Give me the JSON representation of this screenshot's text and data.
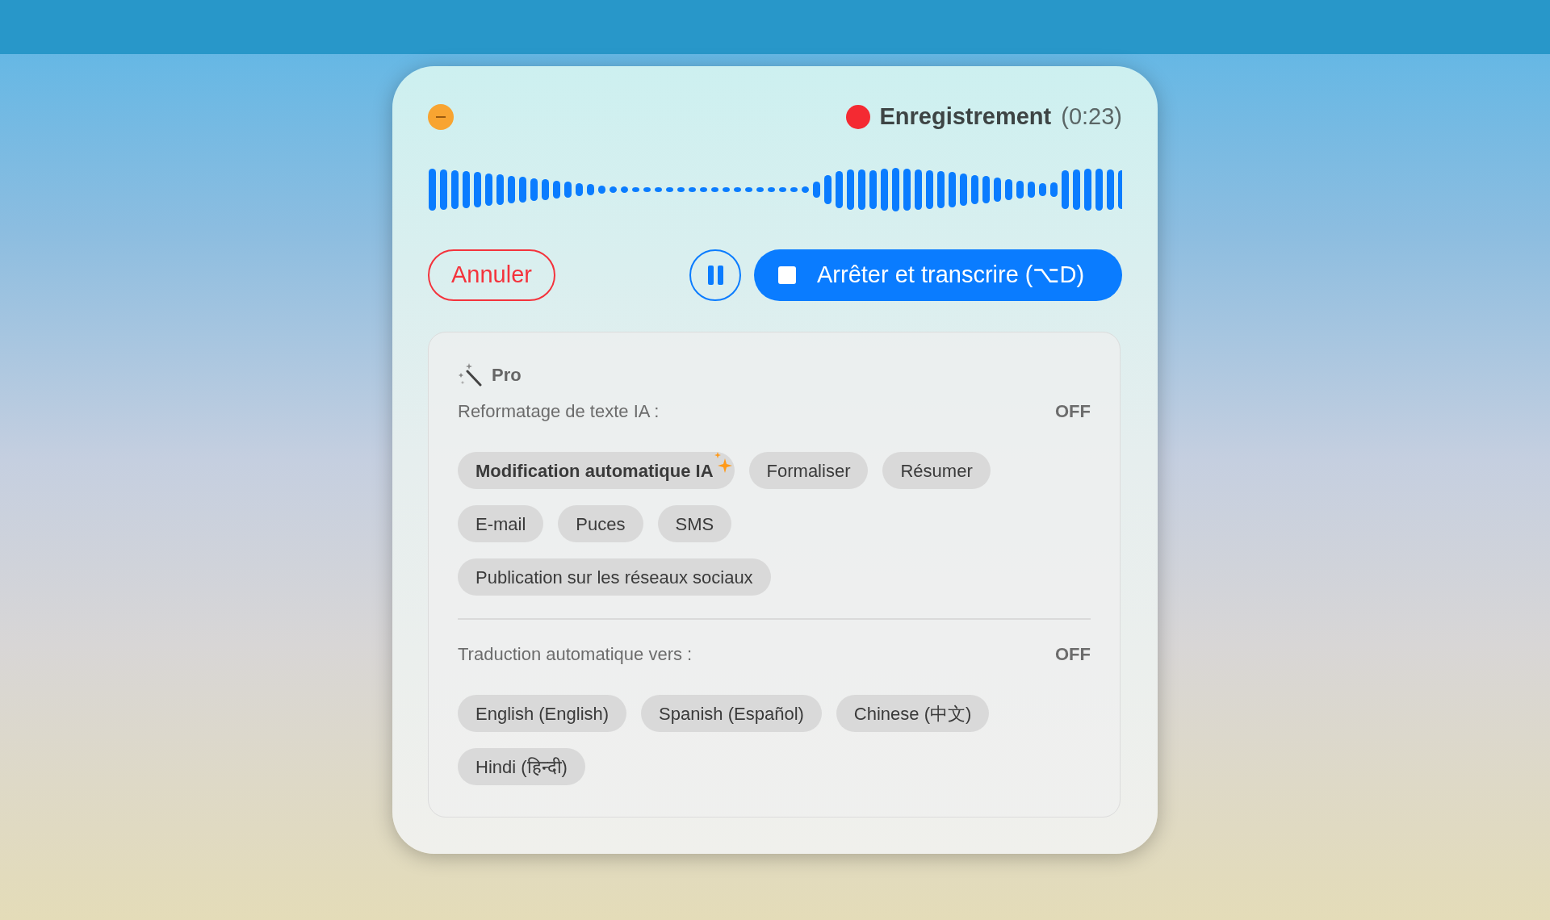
{
  "header": {
    "status": "Enregistrement",
    "time": "(0:23)"
  },
  "controls": {
    "cancel": "Annuler",
    "stop": "Arrêter et transcrire (⌥D)"
  },
  "pro": {
    "label": "Pro",
    "sections": [
      {
        "title": "Reformatage de texte IA :",
        "state": "OFF",
        "chips": [
          {
            "label": "Modification automatique IA",
            "kind": "featured"
          },
          {
            "label": "Formaliser",
            "kind": "normal"
          },
          {
            "label": "Résumer",
            "kind": "normal"
          },
          {
            "label": "E-mail",
            "kind": "normal"
          },
          {
            "label": "Puces",
            "kind": "normal"
          },
          {
            "label": "SMS",
            "kind": "normal"
          },
          {
            "label": "Publication sur les réseaux sociaux",
            "kind": "normal"
          }
        ]
      },
      {
        "title": "Traduction automatique vers :",
        "state": "OFF",
        "chips": [
          {
            "label": "English (English)",
            "kind": "normal"
          },
          {
            "label": "Spanish (Español)",
            "kind": "normal"
          },
          {
            "label": "Chinese (中文)",
            "kind": "normal"
          },
          {
            "label": "Hindi (हिन्दी)",
            "kind": "normal"
          }
        ]
      }
    ]
  }
}
